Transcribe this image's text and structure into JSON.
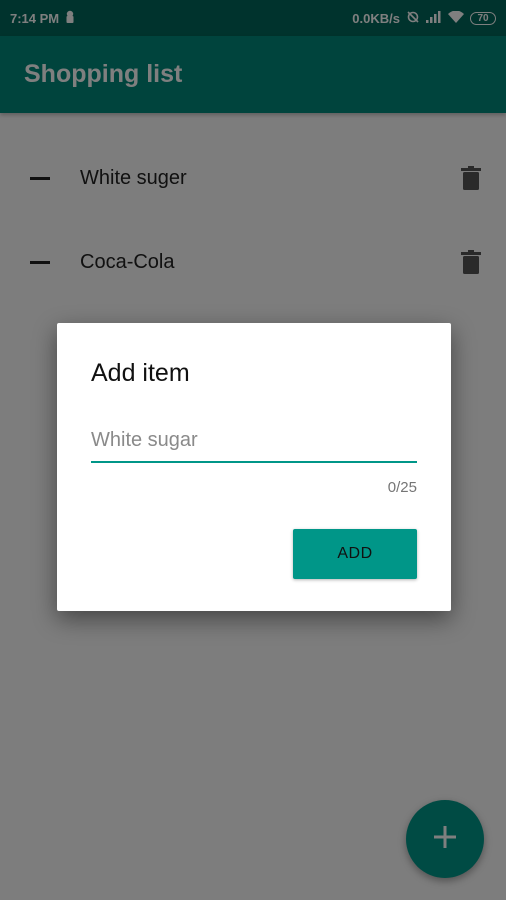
{
  "status_bar": {
    "time": "7:14 PM",
    "network_speed": "0.0KB/s",
    "battery": "70",
    "icons": [
      "lock-icon",
      "no-sync-icon",
      "signal-icon",
      "wifi-icon",
      "battery-icon"
    ]
  },
  "app_bar": {
    "title": "Shopping list",
    "color": "#00897b"
  },
  "list": {
    "items": [
      {
        "label": "White suger",
        "icon": "dash-icon",
        "delete_icon": "trash-icon"
      },
      {
        "label": "Coca-Cola",
        "icon": "dash-icon",
        "delete_icon": "trash-icon"
      }
    ]
  },
  "dialog": {
    "title": "Add item",
    "input_value": "",
    "input_placeholder": "White sugar",
    "counter": "0/25",
    "add_label": "ADD"
  },
  "fab": {
    "icon": "plus-icon",
    "color": "#009688"
  }
}
